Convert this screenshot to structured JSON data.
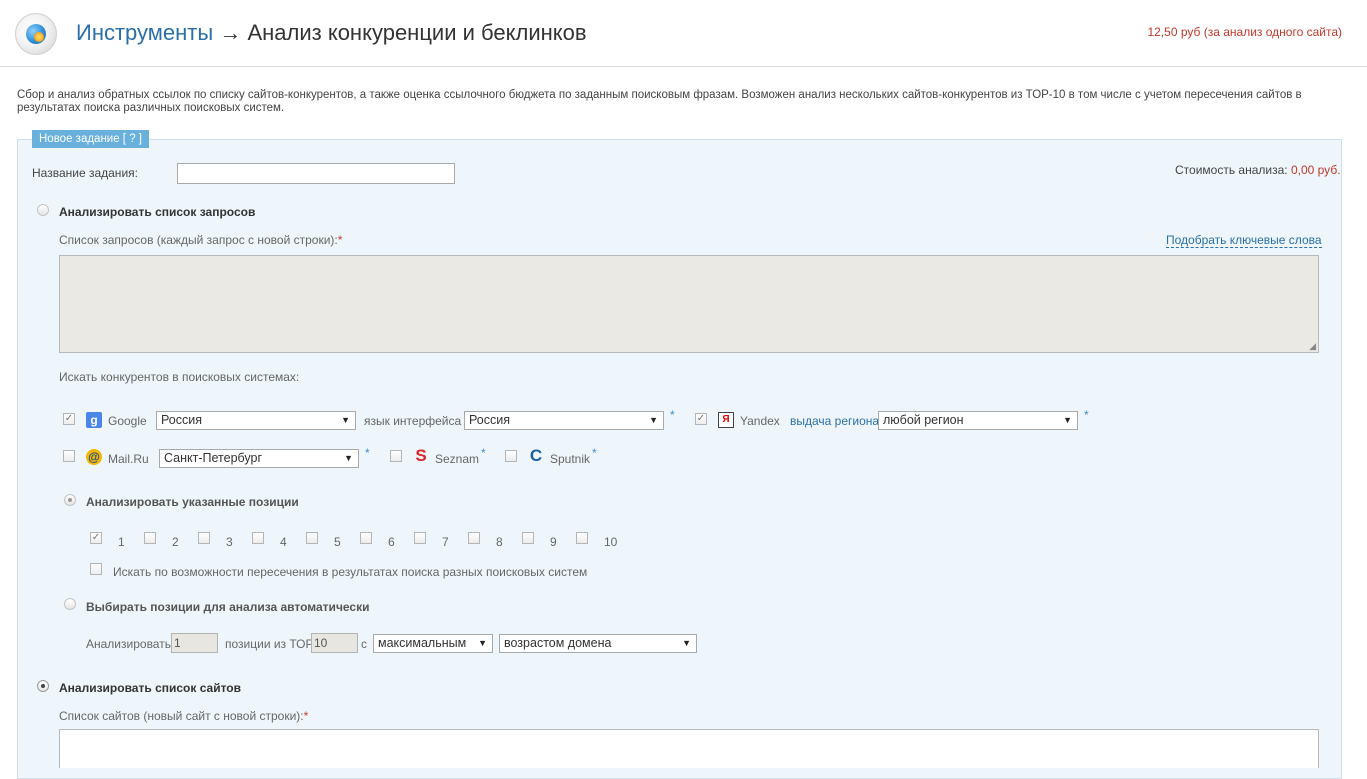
{
  "header": {
    "breadcrumb_link": "Инструменты",
    "arrow": "→",
    "title": "Анализ конкуренции и беклинков",
    "price": "12,50 руб (за анализ одного сайта)"
  },
  "description": "Сбор и анализ обратных ссылок по списку сайтов-конкурентов, а также оценка ссылочного бюджета по заданным поисковым фразам. Возможен анализ нескольких сайтов-конкурентов из ТОР-10 в том числе с учетом пересечения сайтов в результатах поиска различных поисковых систем.",
  "form": {
    "legend": "Новое задание [ ? ]",
    "task_name_label": "Название задания:",
    "task_name_value": "",
    "cost_label": "Стоимость анализа:",
    "cost_value": "0,00 руб.",
    "option_queries": {
      "label": "Анализировать список запросов",
      "checked": false,
      "list_label": "Список запросов (каждый запрос с новой строки):",
      "required_mark": "*",
      "pick_keywords_link": "Подобрать ключевые слова",
      "search_engines_label": "Искать конкурентов в поисковых системах:"
    },
    "engines": {
      "google": {
        "name": "Google",
        "checked": true,
        "region": "Россия",
        "interface_label": "язык интерфейса",
        "interface_value": "Россия",
        "star": "*"
      },
      "yandex": {
        "name": "Yandex",
        "checked": true,
        "region_label": "выдача региона",
        "region": "любой регион",
        "star": "*"
      },
      "mailru": {
        "name": "Mail.Ru",
        "checked": false,
        "region": "Санкт-Петербург",
        "star": "*"
      },
      "seznam": {
        "name": "Seznam",
        "checked": false,
        "star": "*"
      },
      "sputnik": {
        "name": "Sputnik",
        "checked": false,
        "star": "*"
      }
    },
    "positions": {
      "label": "Анализировать указанные позиции",
      "checked": true,
      "items": [
        {
          "label": "1",
          "checked": true
        },
        {
          "label": "2",
          "checked": false
        },
        {
          "label": "3",
          "checked": false
        },
        {
          "label": "4",
          "checked": false
        },
        {
          "label": "5",
          "checked": false
        },
        {
          "label": "6",
          "checked": false
        },
        {
          "label": "7",
          "checked": false
        },
        {
          "label": "8",
          "checked": false
        },
        {
          "label": "9",
          "checked": false
        },
        {
          "label": "10",
          "checked": false
        }
      ],
      "intersection_label": "Искать по возможности пересечения в результатах поиска разных поисковых систем",
      "intersection_checked": false
    },
    "auto": {
      "label": "Выбирать позиции для анализа автоматически",
      "checked": false,
      "analyze_label": "Анализировать",
      "count_value": "1",
      "positions_from_label": "позиции из ТОР-",
      "top_value": "10",
      "with_label": "с",
      "sort_value": "максимальным",
      "criterion_value": "возрастом домена"
    },
    "option_sites": {
      "label": "Анализировать список сайтов",
      "checked": true,
      "list_label": "Список сайтов (новый сайт с новой строки):",
      "required_mark": "*"
    }
  },
  "icons": {
    "dropdown": "▼",
    "check": "✓"
  }
}
